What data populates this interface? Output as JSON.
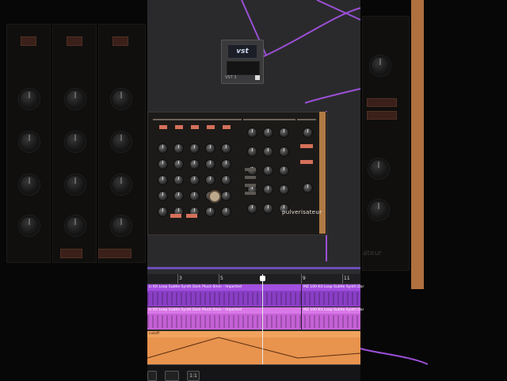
{
  "vst_module": {
    "logo": "vst",
    "label": "VST 3"
  },
  "synth": {
    "brand": "pulverisateur"
  },
  "timeline": {
    "bars": [
      "3",
      "5",
      "9",
      "11"
    ],
    "tracks": [
      {
        "name": "purple-loop",
        "label_left": "ic Kit Loop Subtle Synth Dark Pluck 0min - Imported",
        "label_right": "MZ 100 Kit Loop Subtle Synth Dar",
        "color": "#8a3fc6"
      },
      {
        "name": "pink-loop",
        "label_left": "ic Kit Loop Subtle Synth Dark Pluck 0min - Imported",
        "label_right": "MZ 100 Kit Loop Subtle Synth Dar",
        "color": "#c561d6"
      }
    ],
    "automation": {
      "label": "cutoff",
      "color": "#e8934e"
    }
  },
  "footer": {
    "buttons": [
      "",
      "",
      "1:1"
    ]
  },
  "background": {
    "brand_fragment": "ateur"
  },
  "colors": {
    "wire": "#9b4fd6",
    "accent_orange": "#d4705a",
    "wood": "#b07a45"
  }
}
